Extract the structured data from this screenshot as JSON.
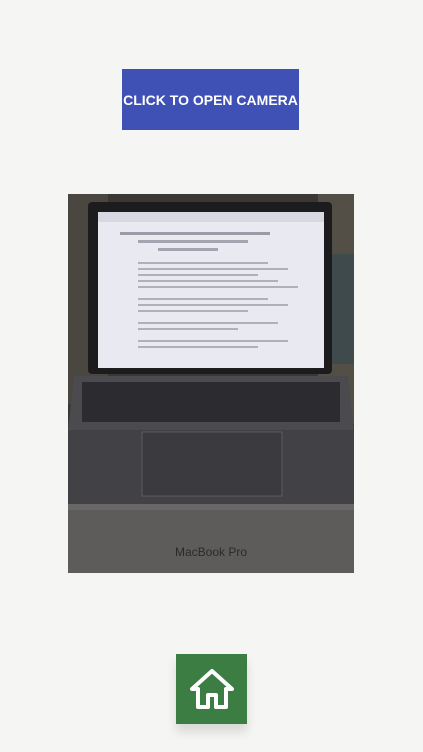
{
  "camera": {
    "button_label": "CLICK TO OPEN CAMERA"
  },
  "photo": {
    "subject": "laptop-photo",
    "caption_on_device": "MacBook Pro"
  },
  "home": {
    "icon": "home-icon"
  },
  "colors": {
    "background": "#f5f6f4",
    "camera_button": "#3f51b5",
    "home_button": "#3b7d43"
  }
}
